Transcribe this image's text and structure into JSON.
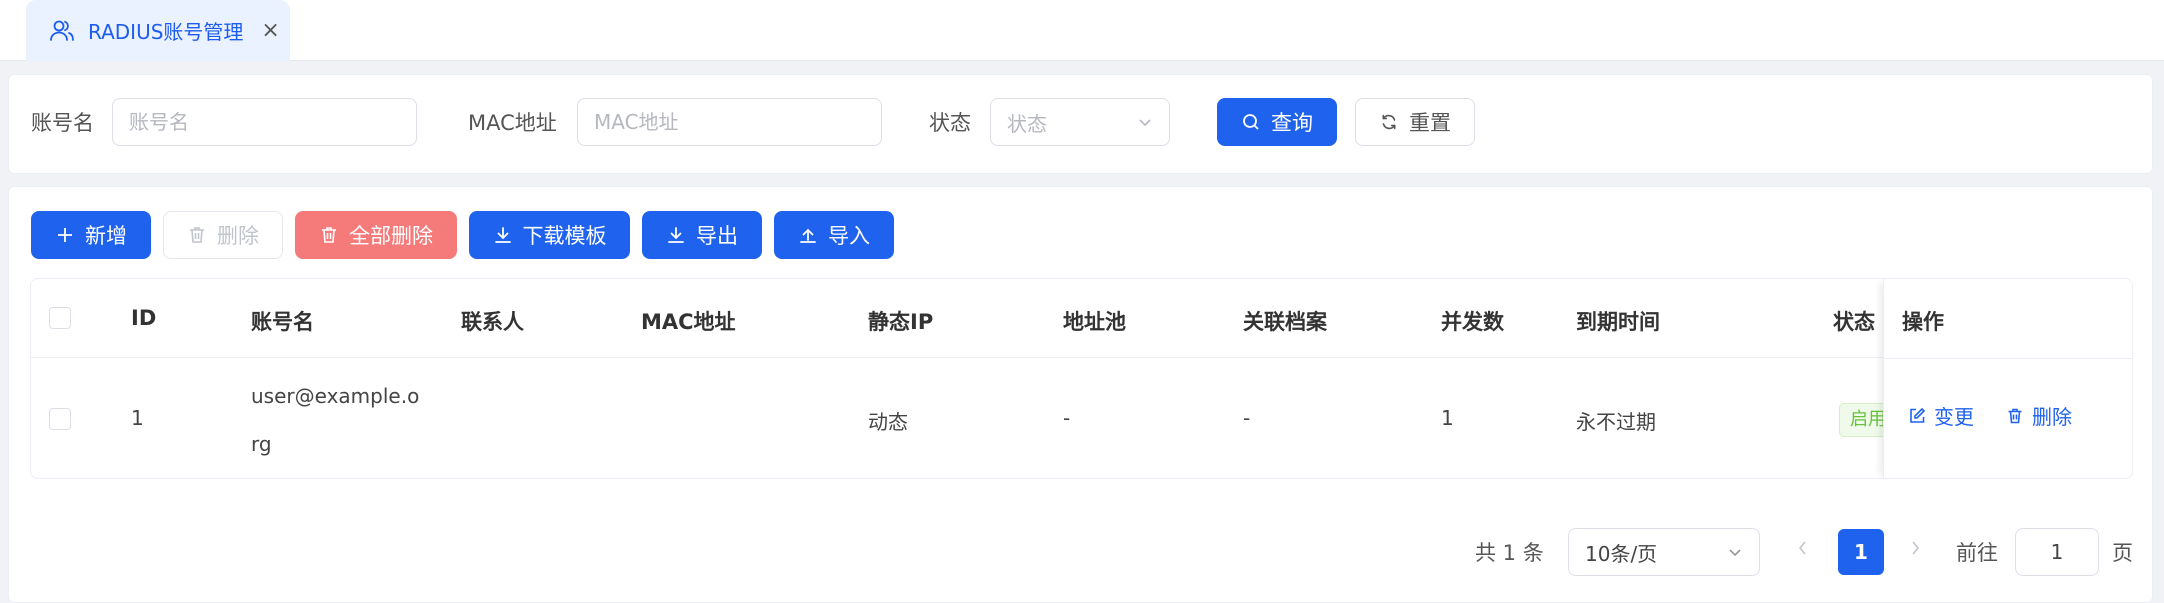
{
  "tab": {
    "label": "RADIUS账号管理",
    "close": "×"
  },
  "search": {
    "account_label": "账号名",
    "account_placeholder": "账号名",
    "mac_label": "MAC地址",
    "mac_placeholder": "MAC地址",
    "status_label": "状态",
    "status_placeholder": "状态",
    "query_button": "查询",
    "reset_button": "重置"
  },
  "toolbar": {
    "add": "新增",
    "delete": "删除",
    "delete_all": "全部删除",
    "download_template": "下载模板",
    "export": "导出",
    "import": "导入"
  },
  "table": {
    "columns": [
      "ID",
      "账号名",
      "联系人",
      "MAC地址",
      "静态IP",
      "地址池",
      "关联档案",
      "并发数",
      "到期时间",
      "状态",
      "操作"
    ],
    "rows": [
      {
        "id": "1",
        "account_line1": "user@example.o",
        "account_line2": "rg",
        "contact": "",
        "mac": "",
        "static_ip": "动态",
        "pool": "-",
        "profile": "-",
        "concurrency": "1",
        "expire": "永不过期",
        "status": "启用",
        "action_edit": "变更",
        "action_delete": "删除"
      }
    ]
  },
  "pagination": {
    "total": "共 1 条",
    "page_size": "10条/页",
    "current_page": "1",
    "goto_label": "前往",
    "goto_value": "1",
    "page_unit": "页"
  },
  "colors": {
    "primary": "#1f62ee",
    "danger": "#f57b7b",
    "success": "#67c23a",
    "tab_bg": "#eaf2ff"
  }
}
